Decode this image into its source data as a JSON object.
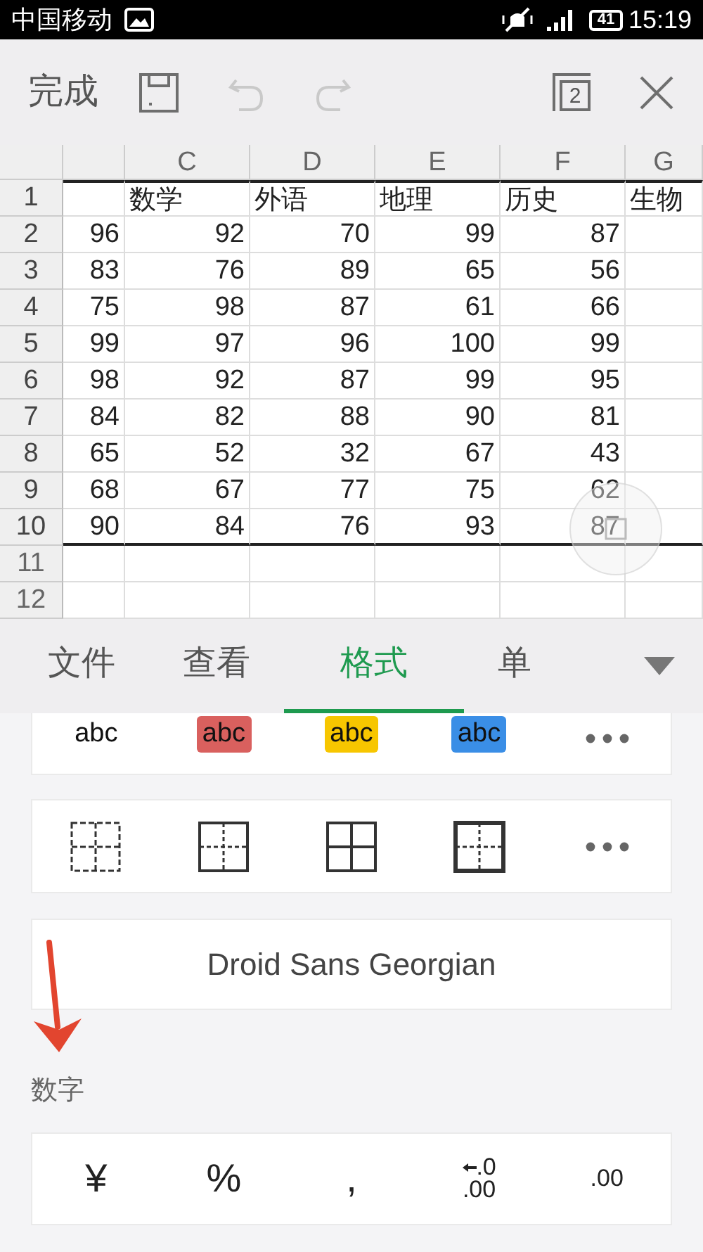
{
  "status_bar": {
    "carrier": "中国移动",
    "battery": "41",
    "time": "15:19"
  },
  "toolbar": {
    "done": "完成",
    "items": [
      {
        "kind": "save",
        "disabled": false
      },
      {
        "kind": "undo",
        "disabled": true
      },
      {
        "kind": "redo",
        "disabled": true
      },
      {
        "kind": "windows",
        "badge": "2",
        "disabled": false
      },
      {
        "kind": "close",
        "disabled": false
      }
    ]
  },
  "sheet": {
    "columns": [
      null,
      "C",
      "D",
      "E",
      "F",
      "G"
    ],
    "rows": [
      {
        "number": "1",
        "selected": true,
        "kind": "text",
        "cells": [
          null,
          "数学",
          "外语",
          "地理",
          "历史",
          "生物"
        ]
      },
      {
        "number": "2",
        "selected": true,
        "kind": "number",
        "cells": [
          "96",
          "92",
          "70",
          "99",
          "87",
          null
        ]
      },
      {
        "number": "3",
        "selected": true,
        "kind": "number",
        "cells": [
          "83",
          "76",
          "89",
          "65",
          "56",
          null
        ]
      },
      {
        "number": "4",
        "selected": true,
        "kind": "number",
        "cells": [
          "75",
          "98",
          "87",
          "61",
          "66",
          null
        ]
      },
      {
        "number": "5",
        "selected": true,
        "kind": "number",
        "cells": [
          "99",
          "97",
          "96",
          "100",
          "99",
          null
        ]
      },
      {
        "number": "6",
        "selected": true,
        "kind": "number",
        "cells": [
          "98",
          "92",
          "87",
          "99",
          "95",
          null
        ]
      },
      {
        "number": "7",
        "selected": true,
        "kind": "number",
        "cells": [
          "84",
          "82",
          "88",
          "90",
          "81",
          null
        ]
      },
      {
        "number": "8",
        "selected": true,
        "kind": "number",
        "cells": [
          "65",
          "52",
          "32",
          "67",
          "43",
          null
        ]
      },
      {
        "number": "9",
        "selected": true,
        "kind": "number",
        "cells": [
          "68",
          "67",
          "77",
          "75",
          "62",
          null
        ]
      },
      {
        "number": "10",
        "selected": true,
        "kind": "number",
        "cells": [
          "90",
          "84",
          "76",
          "93",
          "87",
          null
        ]
      },
      {
        "number": "11",
        "selected": false,
        "kind": "number",
        "cells": [
          null,
          null,
          null,
          null,
          null,
          null
        ]
      },
      {
        "number": "12",
        "selected": false,
        "kind": "number",
        "cells": [
          null,
          null,
          null,
          null,
          null,
          null
        ]
      }
    ]
  },
  "tabs": [
    {
      "label": "文件",
      "selected": false
    },
    {
      "label": "查看",
      "selected": false
    },
    {
      "label": "格式",
      "selected": true
    },
    {
      "label": "单",
      "selected": false
    }
  ],
  "text_styles": [
    {
      "label": "abc"
    },
    {
      "label": "abc",
      "color": "#d9605e"
    },
    {
      "label": "abc",
      "color": "#f7c600"
    },
    {
      "label": "abc",
      "color": "#3a8ee6"
    }
  ],
  "border_styles": [
    {
      "kind": "all-dashed"
    },
    {
      "kind": "outer-solid"
    },
    {
      "kind": "all-solid"
    },
    {
      "kind": "thick-outer"
    }
  ],
  "font": {
    "name": "Droid Sans Georgian"
  },
  "number_section": {
    "title": "数字",
    "formats": [
      {
        "kind": "symbol",
        "label": "¥"
      },
      {
        "kind": "symbol",
        "label": "%"
      },
      {
        "kind": "symbol",
        "label": ","
      },
      {
        "kind": "increase-decimal",
        "top": ".0",
        "bottom": ".00"
      },
      {
        "kind": "decrease-decimal",
        "top": ".00"
      }
    ]
  }
}
